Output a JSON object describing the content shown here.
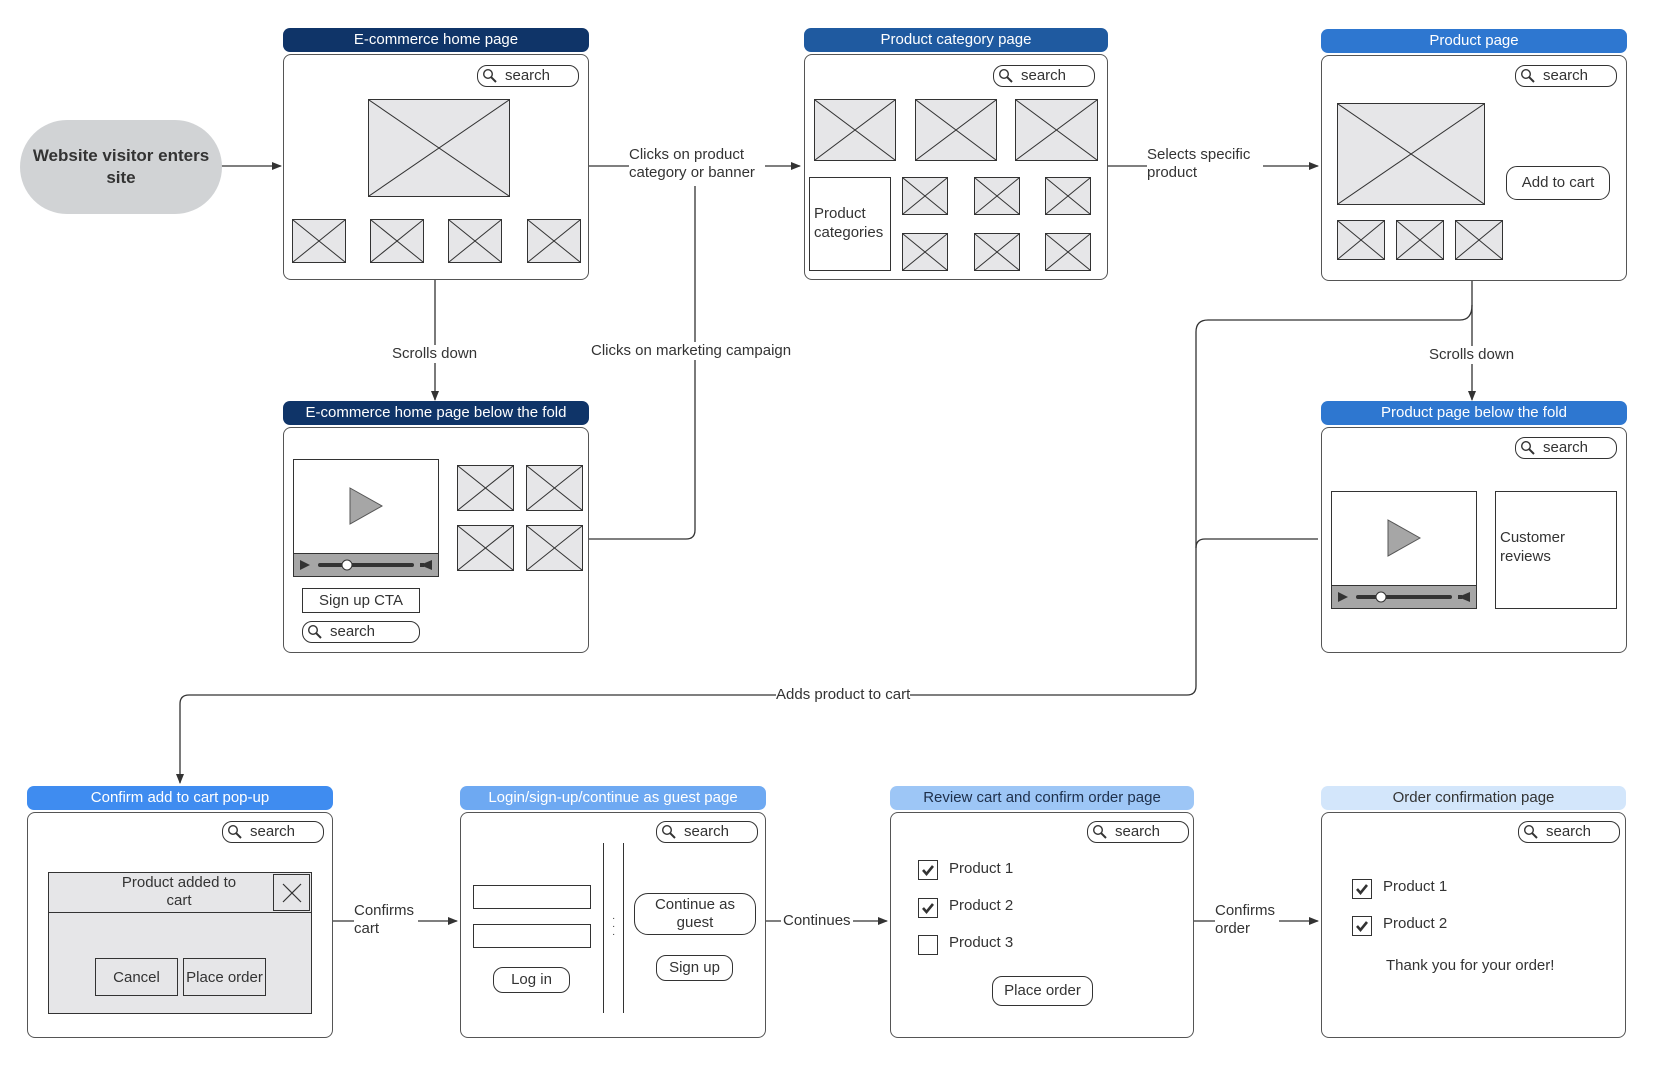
{
  "start_node": {
    "label": "Website visitor enters site"
  },
  "colors": {
    "header_dark": "#0f3468",
    "header_mid": "#1f5aa0",
    "header_blue": "#2e77d0",
    "header_bright": "#3f8cf0",
    "header_light": "#6ea9f2",
    "header_pale": "#9dc6f6",
    "header_palest": "#d3e6fb",
    "start_node_fill": "#d1d3d5"
  },
  "search_label": "search",
  "pages": {
    "home": {
      "title": "E-commerce home page"
    },
    "category": {
      "title": "Product category page",
      "sidebar_label": "Product categories"
    },
    "product": {
      "title": "Product page",
      "add_to_cart": "Add to cart"
    },
    "home_fold": {
      "title": "E-commerce home page below the fold",
      "cta": "Sign up CTA"
    },
    "product_fold": {
      "title": "Product page below the fold",
      "reviews": "Customer reviews"
    },
    "popup": {
      "title": "Confirm add to cart pop-up",
      "message": "Product added to cart",
      "cancel": "Cancel",
      "place_order": "Place order"
    },
    "login": {
      "title": "Login/sign-up/continue as guest page",
      "login": "Log in",
      "guest": "Continue as guest",
      "signup": "Sign up"
    },
    "review": {
      "title": "Review cart and confirm order page",
      "items": [
        {
          "label": "Product 1",
          "checked": true
        },
        {
          "label": "Product 2",
          "checked": true
        },
        {
          "label": "Product 3",
          "checked": false
        }
      ],
      "place_order": "Place order"
    },
    "confirmation": {
      "title": "Order confirmation page",
      "items": [
        {
          "label": "Product 1",
          "checked": true
        },
        {
          "label": "Product 2",
          "checked": true
        }
      ],
      "message": "Thank you for your order!"
    }
  },
  "connectors": {
    "clicks_category": "Clicks on product category or banner",
    "selects_product": "Selects specific product",
    "scrolls_down_home": "Scrolls down",
    "scrolls_down_product": "Scrolls down",
    "marketing": "Clicks on marketing campaign",
    "adds_to_cart": "Adds product to cart",
    "confirms_cart": "Confirms cart",
    "continues": "Continues",
    "confirms_order": "Confirms order"
  }
}
